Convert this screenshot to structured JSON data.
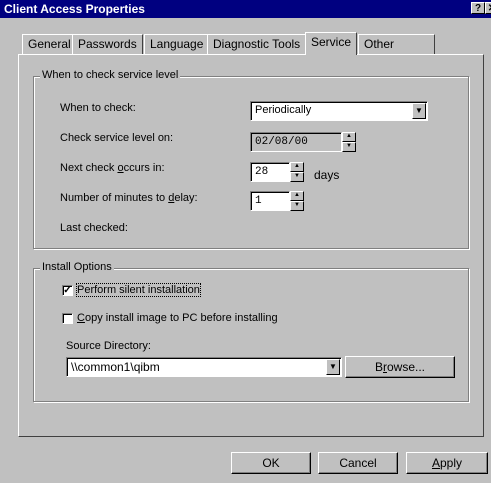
{
  "window": {
    "title": "Client Access Properties",
    "help_button": "?",
    "close_button": "✕"
  },
  "tabs": [
    {
      "label": "General"
    },
    {
      "label": "Passwords"
    },
    {
      "label": "Language"
    },
    {
      "label": "Diagnostic Tools"
    },
    {
      "label": "Service",
      "active": true
    },
    {
      "label": "Other"
    }
  ],
  "service_level": {
    "group_label": "When to check service level",
    "when_to_check_label": "When to check:",
    "when_to_check_value": "Periodically",
    "check_on_label": "Check service level on:",
    "check_on_value": "02/08/00",
    "next_check_label_pre": "Next check ",
    "next_check_label_ul": "o",
    "next_check_label_post": "ccurs in:",
    "next_check_value": "28",
    "next_check_unit": "days",
    "delay_label_pre": "Number of minutes to ",
    "delay_label_ul": "d",
    "delay_label_post": "elay:",
    "delay_value": "1",
    "last_checked_label": "Last checked:"
  },
  "install": {
    "group_label": "Install Options",
    "silent_label": "Perform silent installation",
    "silent_checked": true,
    "copy_label_ul": "C",
    "copy_label_post": "opy install image to PC before installing",
    "copy_checked": false,
    "source_label": "Source Directory:",
    "source_value": "\\\\common1\\qibm",
    "browse_pre": "B",
    "browse_ul": "r",
    "browse_post": "owse..."
  },
  "footer": {
    "ok_label": "OK",
    "cancel_label": "Cancel",
    "apply_ul": "A",
    "apply_post": "pply"
  }
}
